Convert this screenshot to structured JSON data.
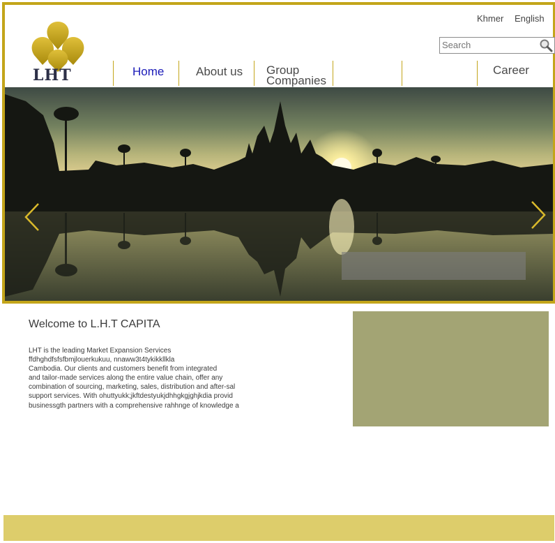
{
  "brand": {
    "logo_text": "LHT",
    "accent": "#c3a51a",
    "logo_gold": "#c9a614"
  },
  "language": {
    "khmer": "Khmer",
    "english": "English"
  },
  "search": {
    "placeholder": "Search",
    "icon": "search-icon"
  },
  "nav": {
    "home": "Home",
    "about": "About us",
    "group_line1": "Group",
    "group_line2": "Companies",
    "career": "Career"
  },
  "slider": {
    "prev_icon": "chevron-left-icon",
    "next_icon": "chevron-right-icon"
  },
  "main": {
    "welcome_title": "Welcome to L.H.T CAPITA",
    "intro_lines": [
      "LHT is the leading Market Expansion Services",
      "ffdhghdfsfsfbmjlouerkukuu, nnaww3t4tykikkllkla",
      "Cambodia. Our clients and customers benefit from integrated",
      "and tailor-made services along the entire value chain, offer any",
      "combination of sourcing, marketing, sales, distribution and after-sal",
      "support services. With ohuttyukk;jkftdestyukjdhhgkgjghjkdia provid",
      "businessgth partners with a comprehensive rahhnge of knowledge a"
    ]
  },
  "colors": {
    "side_panel": "#a3a474",
    "footer": "#ddcd6b",
    "nav_active": "#1a1ab8"
  }
}
